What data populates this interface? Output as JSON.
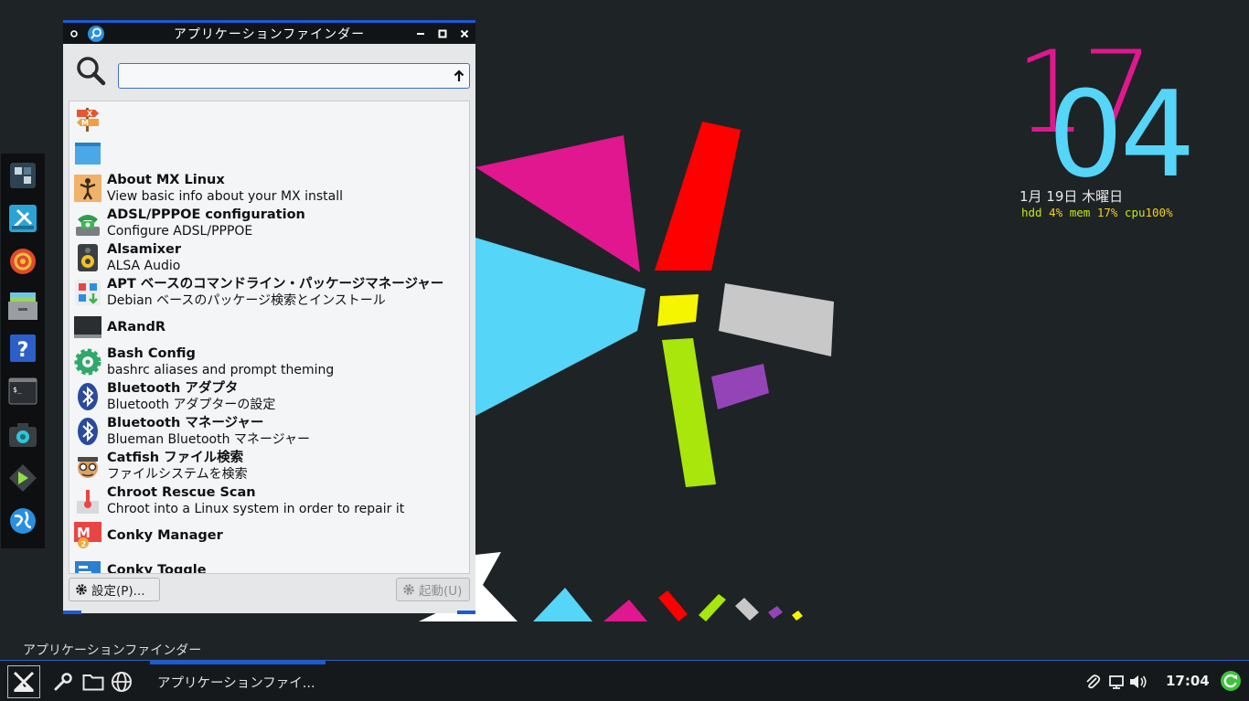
{
  "conky": {
    "hour": "17",
    "minute": "04",
    "date": "1月 19日 木曜日",
    "hdd_label": "hdd",
    "hdd_value": "4%",
    "mem_label": "mem",
    "mem_value": "17%",
    "cpu_label": "cpu",
    "cpu_value": "100%"
  },
  "window": {
    "title": "アプリケーションファインダー",
    "search_value": "",
    "search_placeholder": "",
    "settings_button": "設定(P)...",
    "launch_button": "起動(U)"
  },
  "apps": [
    {
      "name": "",
      "desc": "",
      "icon": "mx-welcome-icon"
    },
    {
      "name": "",
      "desc": "",
      "icon": "window-icon"
    },
    {
      "name": "About MX Linux",
      "desc": "View basic info about your MX install",
      "icon": "person-icon"
    },
    {
      "name": "ADSL/PPPOE configuration",
      "desc": "Configure ADSL/PPPOE",
      "icon": "phone-icon"
    },
    {
      "name": "Alsamixer",
      "desc": "ALSA Audio",
      "icon": "speaker-icon"
    },
    {
      "name": "APT ベースのコマンドライン・パッケージマネージャー",
      "desc": "Debian ベースのパッケージ検索とインストール",
      "icon": "package-icon"
    },
    {
      "name": "ARandR",
      "desc": "",
      "icon": "monitor-icon"
    },
    {
      "name": "Bash Config",
      "desc": "bashrc aliases and prompt theming",
      "icon": "gear-flower-icon"
    },
    {
      "name": "Bluetooth アダプタ",
      "desc": "Bluetooth アダプターの設定",
      "icon": "bluetooth-icon"
    },
    {
      "name": "Bluetooth マネージャー",
      "desc": "Blueman Bluetooth マネージャー",
      "icon": "bluetooth-icon"
    },
    {
      "name": "Catfish ファイル検索",
      "desc": "ファイルシステムを検索",
      "icon": "catfish-icon"
    },
    {
      "name": "Chroot Rescue Scan",
      "desc": "Chroot into a Linux system in order to repair it",
      "icon": "rescue-icon"
    },
    {
      "name": "Conky Manager",
      "desc": "",
      "icon": "conky-manager-icon"
    },
    {
      "name": "Conky Toggle",
      "desc": "",
      "icon": "conky-toggle-icon"
    }
  ],
  "panel": {
    "label": "アプリケーションファインダー",
    "task_title": "アプリケーションファイ...",
    "clock": "17:04"
  },
  "colors": {
    "accent": "#1b5bd6",
    "magenta": "#e0178e",
    "cyan": "#55d5f7",
    "red": "#ff0000",
    "yellow": "#f5f500",
    "green": "#a8e60c",
    "gray": "#c8c8c8",
    "purple": "#9544b8"
  }
}
